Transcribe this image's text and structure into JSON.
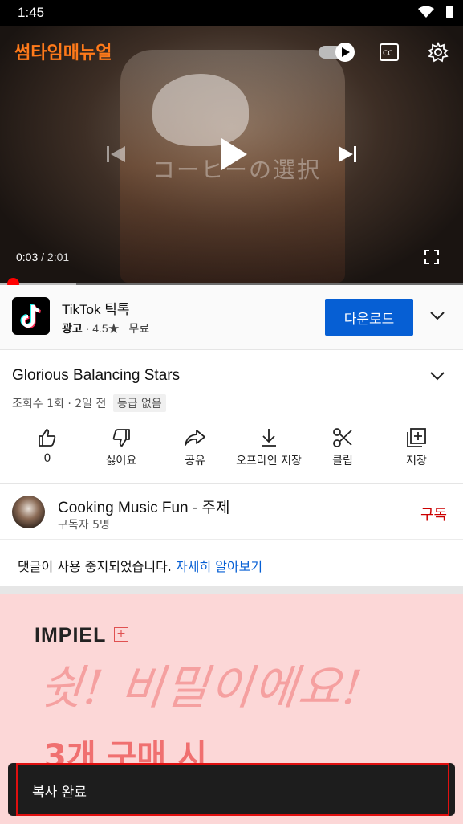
{
  "status_bar": {
    "time": "1:45"
  },
  "video": {
    "brand_logo": "썸타임매뉴얼",
    "overlay_text": "コーヒーの選択",
    "current_time": "0:03",
    "separator": " / ",
    "duration": "2:01",
    "progress_fraction": 0.015,
    "buffered_fraction": 0.165,
    "icons": [
      "autoplay-toggle-icon",
      "captions-icon",
      "settings-icon",
      "previous-icon",
      "play-icon",
      "next-icon",
      "fullscreen-icon"
    ]
  },
  "ad": {
    "app_name": "TikTok 틱톡",
    "ad_label": "광고",
    "dot": " · ",
    "rating": "4.5",
    "rating_star": "★",
    "price": "무료",
    "download_label": "다운로드"
  },
  "video_info": {
    "title": "Glorious Balancing Stars",
    "views": "조회수 1회 · 2일 전",
    "rating_badge": "등급 없음",
    "actions": [
      {
        "label": "0",
        "icon": "like-icon"
      },
      {
        "label": "싫어요",
        "icon": "dislike-icon"
      },
      {
        "label": "공유",
        "icon": "share-icon"
      },
      {
        "label": "오프라인 저장",
        "icon": "download-icon"
      },
      {
        "label": "클립",
        "icon": "clip-icon"
      },
      {
        "label": "저장",
        "icon": "save-playlist-icon"
      }
    ]
  },
  "channel": {
    "name": "Cooking Music Fun - 주제",
    "subscribers": "구독자 5명",
    "subscribe_label": "구독"
  },
  "comments": {
    "message": "댓글이 사용 중지되었습니다.",
    "link": "자세히 알아보기"
  },
  "banner": {
    "brand": "IMPIEL",
    "plus": "+",
    "handwriting": "쉿! 비밀이에요!",
    "offer": "3개 구매 시"
  },
  "toast": {
    "text": "복사 완료"
  }
}
